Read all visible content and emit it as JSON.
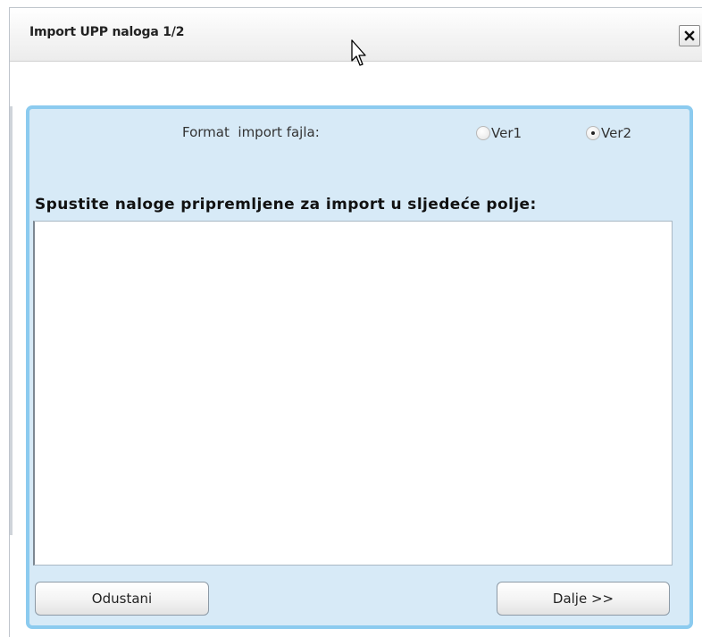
{
  "dialog": {
    "title": "Import UPP naloga 1/2",
    "close_icon": "close-icon"
  },
  "format": {
    "label": "Format  import fajla:",
    "options": [
      {
        "label": "Ver1",
        "checked": false
      },
      {
        "label": "Ver2",
        "checked": true
      }
    ]
  },
  "drop_area": {
    "label": "Spustite naloge pripremljene za import u sljedeće polje:",
    "value": ""
  },
  "buttons": {
    "cancel": "Odustani",
    "next": "Dalje >>"
  },
  "colors": {
    "panel_background": "#d7eaf7",
    "panel_border": "#8ccbef"
  }
}
